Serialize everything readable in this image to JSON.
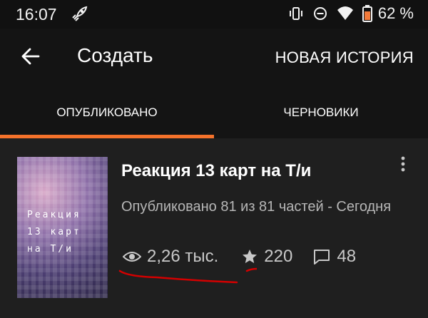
{
  "status_bar": {
    "time": "16:07",
    "battery": "62 %",
    "icons": [
      "rocket-icon",
      "vibrate-icon",
      "dnd-icon",
      "wifi-icon",
      "battery-icon"
    ]
  },
  "app_bar": {
    "title": "Создать",
    "action": "НОВАЯ ИСТОРИЯ"
  },
  "tabs": [
    {
      "label": "ОПУБЛИКОВАНО",
      "active": true
    },
    {
      "label": "ЧЕРНОВИКИ",
      "active": false
    }
  ],
  "story": {
    "cover_text": "Реакция\n13 карт\nна Т/и",
    "title": "Реакция 13 карт на Т/и",
    "status": "Опубликовано 81 из 81 частей - Сегодня",
    "reads": "2,26 тыс.",
    "votes": "220",
    "comments": "48"
  },
  "colors": {
    "accent": "#f5722b",
    "background": "#1f1f1f",
    "bar": "#141414",
    "annotation_red": "#d40000"
  }
}
